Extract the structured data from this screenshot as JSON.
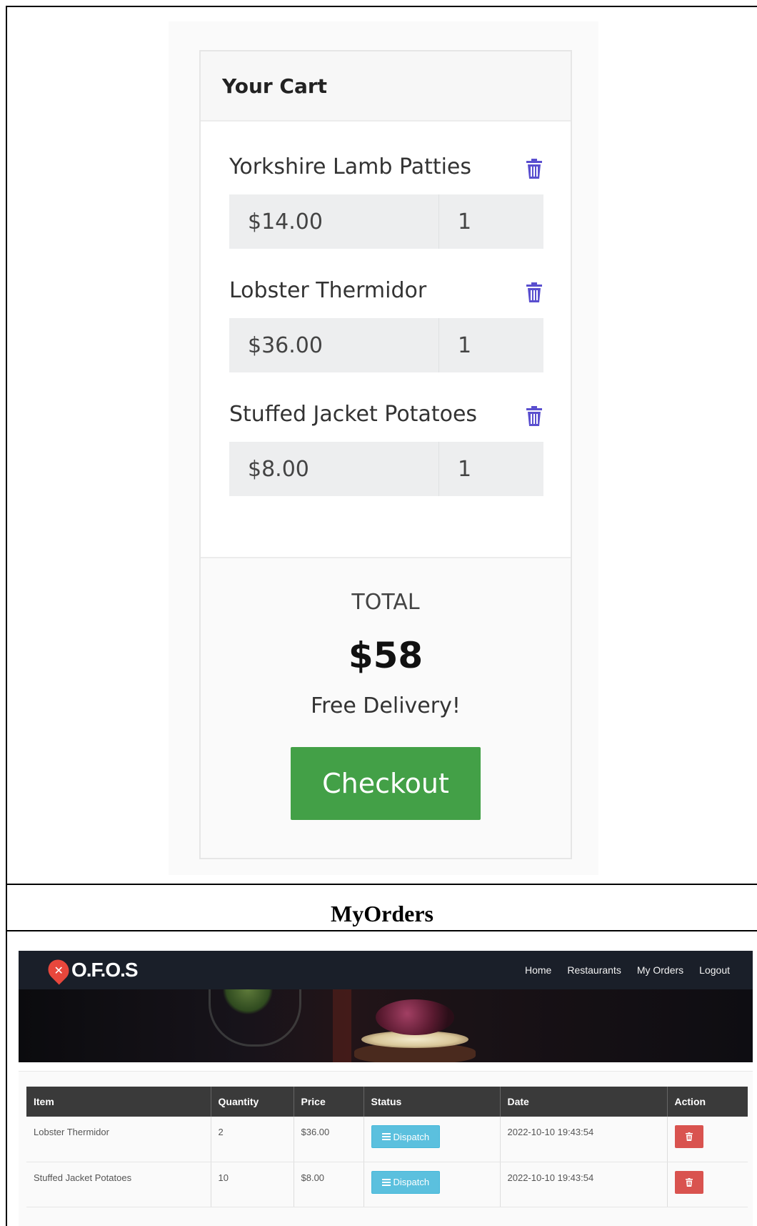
{
  "cart": {
    "title": "Your Cart",
    "items": [
      {
        "name": "Yorkshire Lamb Patties",
        "price": "$14.00",
        "qty": "1"
      },
      {
        "name": "Lobster Thermidor",
        "price": "$36.00",
        "qty": "1"
      },
      {
        "name": "Stuffed Jacket Potatoes",
        "price": "$8.00",
        "qty": "1"
      }
    ],
    "total_label": "TOTAL",
    "total_value": "$58",
    "delivery_note": "Free Delivery!",
    "checkout_label": "Checkout",
    "accent": "#43a047",
    "trash_icon": "trash-icon",
    "trash_color": "#5a4fcf"
  },
  "section_label": "MyOrders",
  "app": {
    "logo_text": "O.F.O.S",
    "logo_icon": "fork-knife-icon",
    "logo_color": "#e8473c",
    "nav": [
      "Home",
      "Restaurants",
      "My Orders",
      "Logout"
    ],
    "table": {
      "headers": [
        "Item",
        "Quantity",
        "Price",
        "Status",
        "Date",
        "Action"
      ],
      "rows": [
        {
          "item": "Lobster Thermidor",
          "quantity": "2",
          "price": "$36.00",
          "status": "Dispatch",
          "date": "2022-10-10 19:43:54"
        },
        {
          "item": "Stuffed Jacket Potatoes",
          "quantity": "10",
          "price": "$8.00",
          "status": "Dispatch",
          "date": "2022-10-10 19:43:54"
        }
      ]
    },
    "status_color": "#5bc0de",
    "delete_color": "#d9534f"
  }
}
